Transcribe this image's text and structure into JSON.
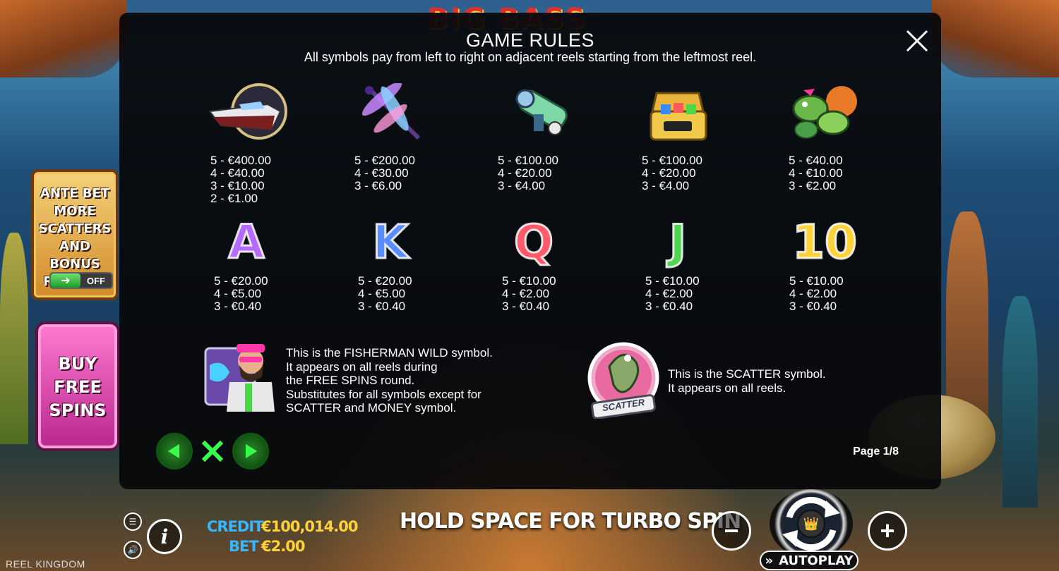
{
  "background": {
    "logo_text": "BIG BASS"
  },
  "ante_bet": {
    "text": "ANTE BET\nMORE\nSCATTERS\nAND BONUS\nREPEATS",
    "toggle_state": "OFF"
  },
  "buy_free_spins": {
    "text": "BUY\nFREE\nSPINS"
  },
  "modal": {
    "title": "GAME RULES",
    "subtitle": "All symbols pay from left to right on adjacent reels starting from the leftmost reel.",
    "page_label": "Page 1/8",
    "paytable_row1": [
      {
        "name": "speedboat",
        "icon": "speedboat-icon",
        "pays": [
          "5 - €400.00",
          "4 - €40.00",
          "3 - €10.00",
          "2 - €1.00"
        ]
      },
      {
        "name": "dragonfly",
        "icon": "dragonfly-icon",
        "pays": [
          "5 - €200.00",
          "4 - €30.00",
          "3 - €6.00"
        ]
      },
      {
        "name": "fishing-reel",
        "icon": "fishing-reel-icon",
        "pays": [
          "5 - €100.00",
          "4 - €20.00",
          "3 - €4.00"
        ]
      },
      {
        "name": "tackle-box",
        "icon": "tackle-box-icon",
        "pays": [
          "5 - €100.00",
          "4 - €20.00",
          "3 - €4.00"
        ]
      },
      {
        "name": "fish-lures",
        "icon": "fish-lures-icon",
        "pays": [
          "5 - €40.00",
          "4 - €10.00",
          "3 - €2.00"
        ]
      }
    ],
    "paytable_row2": [
      {
        "name": "letter-a",
        "glyph": "A",
        "color": "#b66bff",
        "pays": [
          "5 - €20.00",
          "4 - €5.00",
          "3 - €0.40"
        ]
      },
      {
        "name": "letter-k",
        "glyph": "K",
        "color": "#5a8cff",
        "pays": [
          "5 - €20.00",
          "4 - €5.00",
          "3 - €0.40"
        ]
      },
      {
        "name": "letter-q",
        "glyph": "Q",
        "color": "#ff5a6a",
        "pays": [
          "5 - €10.00",
          "4 - €2.00",
          "3 - €0.40"
        ]
      },
      {
        "name": "letter-j",
        "glyph": "J",
        "color": "#4fd84f",
        "pays": [
          "5 - €10.00",
          "4 - €2.00",
          "3 - €0.40"
        ]
      },
      {
        "name": "number-10",
        "glyph": "10",
        "color": "#ffd23a",
        "pays": [
          "5 - €10.00",
          "4 - €2.00",
          "3 - €0.40"
        ]
      }
    ],
    "wild_description": "This is the FISHERMAN WILD symbol.\nIt appears on all reels during\nthe FREE SPINS round.\nSubstitutes for all symbols except for\nSCATTER and MONEY symbol.",
    "scatter_description": "This is the SCATTER symbol.\nIt appears on all reels.",
    "scatter_badge": "SCATTER"
  },
  "bottom_bar": {
    "credit_label": "CREDIT",
    "credit_value": "€100,014.00",
    "bet_label": "BET",
    "bet_value": "€2.00",
    "turbo_hint": "HOLD SPACE FOR TURBO SPIN",
    "autoplay_label": "AUTOPLAY",
    "brand": "REEL KINGDOM"
  }
}
